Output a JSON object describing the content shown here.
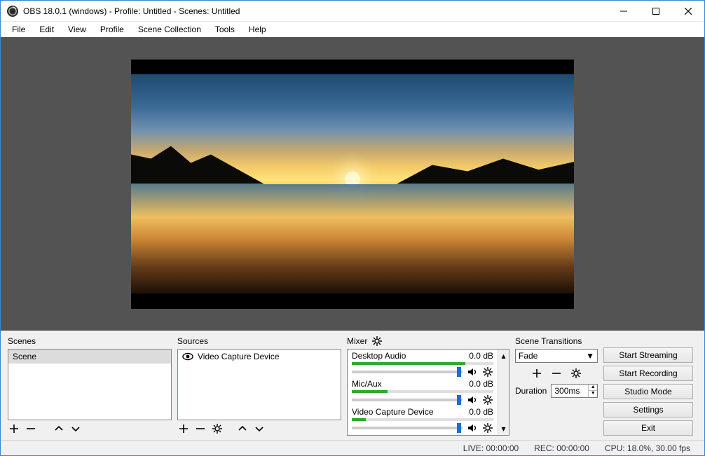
{
  "titlebar": {
    "title": "OBS 18.0.1 (windows) - Profile: Untitled - Scenes: Untitled"
  },
  "menubar": {
    "items": [
      "File",
      "Edit",
      "View",
      "Profile",
      "Scene Collection",
      "Tools",
      "Help"
    ]
  },
  "panels": {
    "scenes": {
      "header": "Scenes",
      "items": [
        "Scene"
      ]
    },
    "sources": {
      "header": "Sources",
      "items": [
        "Video Capture Device"
      ]
    },
    "mixer": {
      "header": "Mixer",
      "channels": [
        {
          "name": "Desktop Audio",
          "db": "0.0 dB",
          "level": 80,
          "slider": 95
        },
        {
          "name": "Mic/Aux",
          "db": "0.0 dB",
          "level": 25,
          "slider": 95
        },
        {
          "name": "Video Capture Device",
          "db": "0.0 dB",
          "level": 10,
          "slider": 95
        }
      ]
    },
    "transitions": {
      "header": "Scene Transitions",
      "selected": "Fade",
      "duration_label": "Duration",
      "duration_value": "300ms"
    }
  },
  "buttons": {
    "start_streaming": "Start Streaming",
    "start_recording": "Start Recording",
    "studio_mode": "Studio Mode",
    "settings": "Settings",
    "exit": "Exit"
  },
  "statusbar": {
    "live": "LIVE: 00:00:00",
    "rec": "REC: 00:00:00",
    "cpu": "CPU: 18.0%, 30.00 fps"
  }
}
